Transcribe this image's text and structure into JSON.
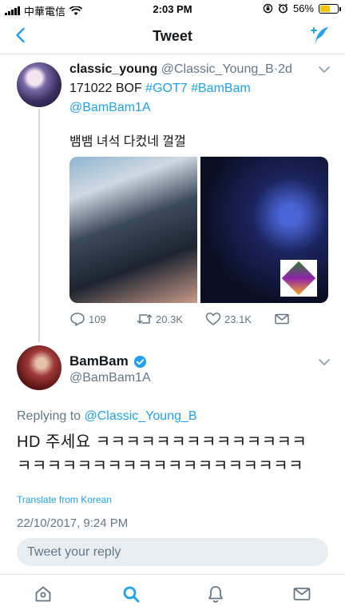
{
  "status_bar": {
    "carrier": "中華電信",
    "time": "2:03 PM",
    "battery": "56%",
    "battery_level": 0.56,
    "battery_color": "#f5c400",
    "icons": [
      "signal-icon",
      "wifi-icon",
      "rotation-lock-icon",
      "alarm-icon",
      "battery-icon"
    ]
  },
  "nav": {
    "title": "Tweet",
    "back_icon": "chevron-left-icon",
    "compose_icon": "compose-tweet-icon"
  },
  "tweet1": {
    "display_name": "classic_young",
    "handle": "@Classic_Young_B",
    "separator": "·",
    "time": "2d",
    "text_prefix": "171022 BOF ",
    "hashtag1": "#GOT7",
    "hashtag2": "#BamBam",
    "mention": "@BamBam1A",
    "korean_text": "뱀뱀 녀석 다컸네 껄껄",
    "stats": {
      "replies": "109",
      "retweets": "20.3K",
      "likes": "23.1K"
    }
  },
  "tweet2": {
    "display_name": "BamBam",
    "verified": true,
    "handle": "@BamBam1A",
    "replying_label": "Replying to ",
    "replying_to": "@Classic_Young_B",
    "text_line1": "HD 주세요 ㅋㅋㅋㅋㅋㅋㅋㅋㅋㅋㅋㅋㅋㅋ",
    "text_line2": "ㅋㅋㅋㅋㅋㅋㅋㅋㅋㅋㅋㅋㅋㅋㅋㅋㅋㅋㅋ",
    "translate": "Translate from Korean",
    "timestamp": "22/10/2017, 9:24 PM"
  },
  "reply_input": {
    "placeholder": "Tweet your reply"
  },
  "tabbar": {
    "items": [
      "home-icon",
      "search-icon",
      "notifications-icon",
      "messages-icon"
    ],
    "active": "search-icon"
  },
  "colors": {
    "accent": "#1da1f2",
    "secondary_text": "#657786",
    "verified": "#1da1f2"
  }
}
